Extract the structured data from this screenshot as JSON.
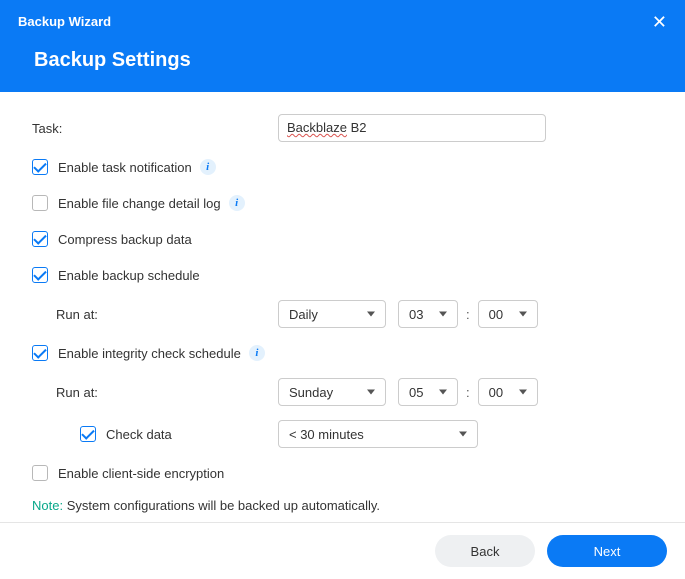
{
  "header": {
    "wizard_title": "Backup Wizard",
    "page_title": "Backup Settings",
    "close_glyph": "✕"
  },
  "task": {
    "label": "Task:",
    "value_underlined": "Backblaze",
    "value_rest": " B2"
  },
  "options": {
    "notification": {
      "label": "Enable task notification",
      "checked": true,
      "has_info": true
    },
    "filelog": {
      "label": "Enable file change detail log",
      "checked": false,
      "has_info": true
    },
    "compress": {
      "label": "Compress backup data",
      "checked": true,
      "has_info": false
    },
    "schedule": {
      "label": "Enable backup schedule",
      "checked": true,
      "has_info": false
    },
    "integrity": {
      "label": "Enable integrity check schedule",
      "checked": true,
      "has_info": true
    },
    "checkdata": {
      "label": "Check data",
      "checked": true,
      "has_info": false
    },
    "encryption": {
      "label": "Enable client-side encryption",
      "checked": false,
      "has_info": false
    }
  },
  "schedule": {
    "runat_label": "Run at:",
    "freq": "Daily",
    "hour": "03",
    "minute": "00",
    "colon": ":"
  },
  "integrity": {
    "runat_label": "Run at:",
    "freq": "Sunday",
    "hour": "05",
    "minute": "00",
    "colon": ":",
    "duration": "< 30 minutes"
  },
  "note": {
    "label": "Note:",
    "text": " System configurations will be backed up automatically."
  },
  "footer": {
    "back": "Back",
    "next": "Next"
  },
  "info_glyph": "i"
}
